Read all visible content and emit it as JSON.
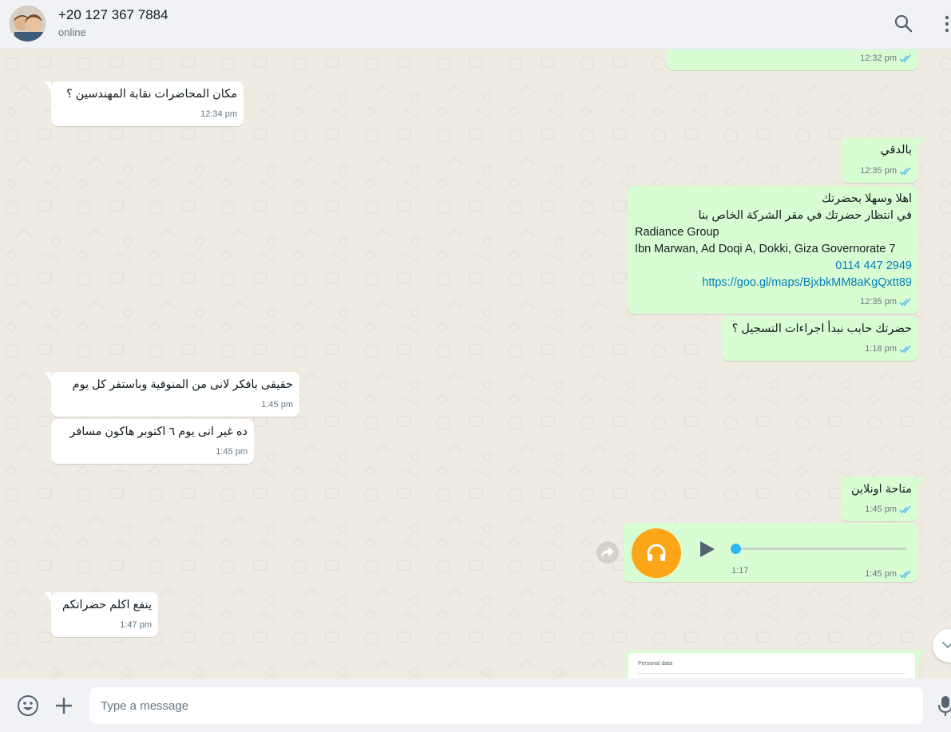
{
  "header": {
    "contact_name": "+20 127 367 7884",
    "status": "online",
    "icons": [
      "search-icon",
      "menu-icon"
    ]
  },
  "messages": [
    {
      "id": "m0",
      "dir": "out",
      "text": "",
      "time": "12:32 pm"
    },
    {
      "id": "m1",
      "dir": "in",
      "text": "مكان المحاضرات نقابة المهندسين ؟",
      "time": "12:34 pm"
    },
    {
      "id": "m2",
      "dir": "out",
      "text": "بالدقي",
      "time": "12:35 pm"
    },
    {
      "id": "m3",
      "dir": "out",
      "lines": [
        "اهلا وسهلا بحضرتك",
        "في انتظار حضرتك في مقر الشركة الخاص بنا",
        "Radiance Group",
        "Ibn Marwan, Ad Doqi A, Dokki, Giza Governorate 7"
      ],
      "phone": "2949 447 0114",
      "link": "https://goo.gl/maps/BjxbkMM8aKgQxtt89",
      "time": "12:35 pm"
    },
    {
      "id": "m4",
      "dir": "out",
      "text": "حضرتك حابب نبدأ اجراءات التسجيل ؟",
      "time": "1:18 pm"
    },
    {
      "id": "m5",
      "dir": "in",
      "text": "حقيقى بافكر لانى من المنوفية وباستفر كل يوم",
      "time": "1:45 pm"
    },
    {
      "id": "m6",
      "dir": "in",
      "text": "ده غير انى يوم ٦ اكتوبر هاكون مسافر",
      "time": "1:45 pm"
    },
    {
      "id": "m7",
      "dir": "out",
      "text": "متاحة اونلاين",
      "time": "1:45 pm"
    },
    {
      "id": "m9",
      "dir": "in",
      "text": "ينفع اكلم حضراتكم",
      "time": "1:47 pm"
    }
  ],
  "voice_note": {
    "duration": "1:17",
    "time": "1:45 pm",
    "progress": 0,
    "accent": "#fca617"
  },
  "document": {
    "preview_text": "Personal data"
  },
  "footer": {
    "input_placeholder": "Type a message",
    "input_value": "",
    "icons": [
      "emoji-icon",
      "attach-icon",
      "mic-icon"
    ]
  },
  "colors": {
    "outgoing_bubble": "#d9fdd3",
    "incoming_bubble": "#ffffff",
    "chat_bg": "#efeae2",
    "read_ticks": "#53bdeb",
    "link": "#027eb5"
  }
}
